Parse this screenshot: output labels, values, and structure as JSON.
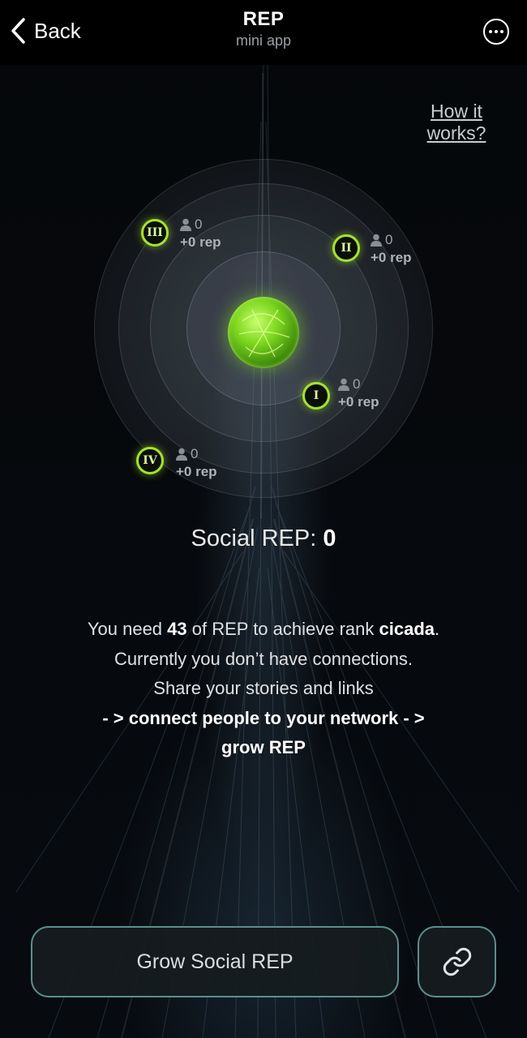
{
  "header": {
    "back_label": "Back",
    "title": "REP",
    "subtitle": "mini app",
    "more_icon": "ellipsis-circle-icon"
  },
  "how_it_works": {
    "line1": "How it",
    "line2": "works?"
  },
  "tiers": [
    {
      "numeral": "I",
      "connections": "0",
      "rep": "+0 rep"
    },
    {
      "numeral": "II",
      "connections": "0",
      "rep": "+0 rep"
    },
    {
      "numeral": "III",
      "connections": "0",
      "rep": "+0 rep"
    },
    {
      "numeral": "IV",
      "connections": "0",
      "rep": "+0 rep"
    }
  ],
  "social_rep": {
    "label": "Social REP:",
    "value": "0"
  },
  "info": {
    "line1_pre": "You need",
    "line1_amount": "43",
    "line1_mid": "of REP to achieve rank",
    "line1_rank": "cicada",
    "line1_post": ".",
    "line2": "Currently you don’t have connections.",
    "line3": "Share your stories and links",
    "line4": "- > connect people to your network - >",
    "line5": "grow REP"
  },
  "actions": {
    "grow_label": "Grow Social REP",
    "link_icon": "link-icon"
  },
  "colors": {
    "accent_green": "#a6e22e",
    "button_border": "#5a8f8c",
    "background": "#05080c"
  }
}
